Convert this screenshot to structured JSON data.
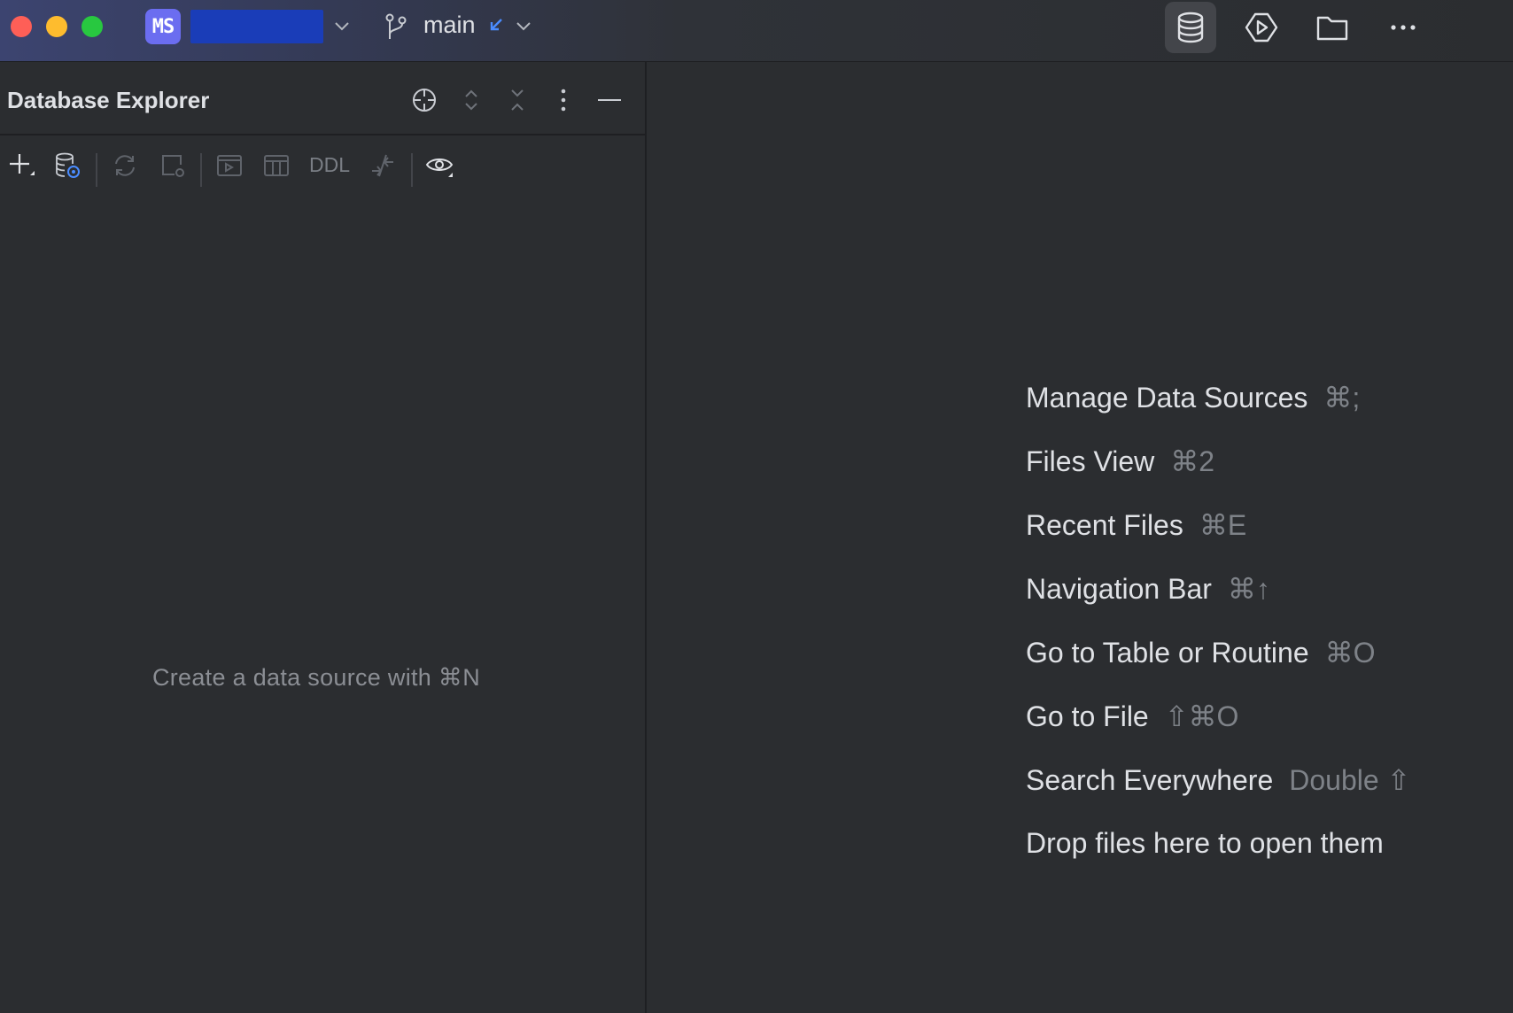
{
  "titlebar": {
    "project_badge": "MS",
    "project_name": "",
    "branch": "main",
    "icons": [
      "database-icon",
      "run-icon",
      "folder-icon",
      "more-icon"
    ]
  },
  "panel": {
    "title": "Database Explorer",
    "toolbar_ddl": "DDL",
    "empty_hint": "Create a data source with ⌘N"
  },
  "hints": [
    {
      "label": "Manage Data Sources",
      "key": "⌘;"
    },
    {
      "label": "Files View",
      "key": "⌘2"
    },
    {
      "label": "Recent Files",
      "key": "⌘E"
    },
    {
      "label": "Navigation Bar",
      "key": "⌘↑"
    },
    {
      "label": "Go to Table or Routine",
      "key": "⌘O"
    },
    {
      "label": "Go to File",
      "key": "⇧⌘O"
    },
    {
      "label": "Search Everywhere",
      "key": "Double ⇧"
    },
    {
      "label": "Drop files here to open them",
      "key": ""
    }
  ],
  "colors": {
    "background": "#2b2d30",
    "accent": "#6b6df0",
    "project_highlight": "#1a3db8",
    "muted_text": "#7e8288"
  }
}
